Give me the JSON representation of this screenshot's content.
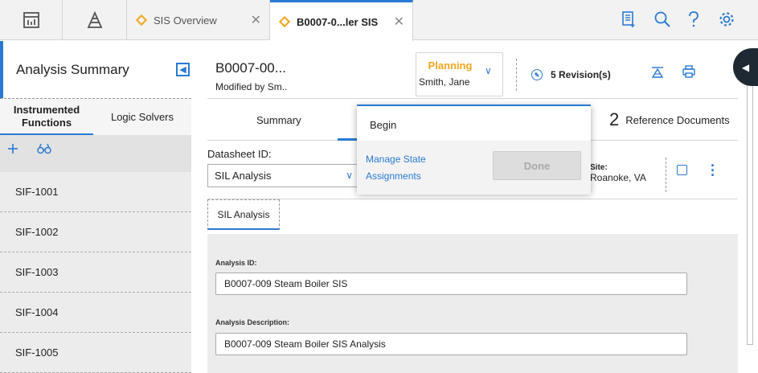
{
  "topbar": {
    "tabs": [
      {
        "label": "SIS Overview",
        "close": "✕"
      },
      {
        "label": "B0007-0...ler SIS",
        "close": "✕"
      }
    ],
    "icons": [
      "dashboard-icon",
      "hierarchy-icon",
      "add-record-icon",
      "search-icon",
      "help-icon",
      "settings-icon"
    ]
  },
  "sidebar": {
    "title": "Analysis Summary",
    "tabs": [
      {
        "label": "Instrumented Functions"
      },
      {
        "label": "Logic Solvers"
      }
    ],
    "items": [
      {
        "label": "SIF-1001"
      },
      {
        "label": "SIF-1002"
      },
      {
        "label": "SIF-1003"
      },
      {
        "label": "SIF-1004"
      },
      {
        "label": "SIF-1005"
      }
    ]
  },
  "record": {
    "title": "B0007-00...",
    "modified_by": "Modified by Sm..",
    "state": "Planning",
    "state_user": "Smith, Jane",
    "revisions": "5 Revision(s)"
  },
  "tabs": {
    "summary": "Summary",
    "ref_count": "2",
    "ref_label": "Reference Documents"
  },
  "datasheet": {
    "label": "Datasheet ID:",
    "value": "SIL Analysis",
    "site_label": "Site:",
    "site_value": "Roanoke, VA",
    "section_tab": "SIL Analysis"
  },
  "form": {
    "analysis_id_label": "Analysis ID:",
    "analysis_id_value": "B0007-009 Steam Boiler SIS",
    "analysis_desc_label": "Analysis Description:",
    "analysis_desc_value": "B0007-009 Steam Boiler SIS Analysis"
  },
  "popup": {
    "begin": "Begin",
    "manage": "Manage State Assignments",
    "done": "Done"
  },
  "colors": {
    "accent": "#2a7ad3",
    "state": "#f2a51c"
  }
}
